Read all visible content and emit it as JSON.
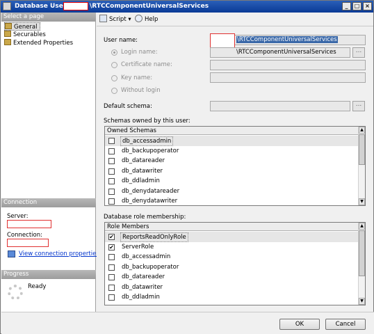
{
  "window": {
    "title_prefix": "Database User -",
    "title_suffix": "\\RTCComponentUniversalServices",
    "minimize": "_",
    "maximize": "□",
    "close": "×"
  },
  "sidebar": {
    "select_page_header": "Select a page",
    "items": [
      {
        "label": "General",
        "icon": "page-icon"
      },
      {
        "label": "Securables",
        "icon": "page-icon"
      },
      {
        "label": "Extended Properties",
        "icon": "page-icon"
      }
    ],
    "connection_header": "Connection",
    "server_label": "Server:",
    "connection_label": "Connection:",
    "view_connection_properties": "View connection properties",
    "progress_header": "Progress",
    "progress_status": "Ready"
  },
  "toolbar": {
    "script_label": "Script",
    "script_dropdown": "▾",
    "help_label": "Help"
  },
  "form": {
    "user_name_label": "User name:",
    "user_name_value": "\\RTCComponentUniversalServices",
    "login_name_label": "Login name:",
    "login_name_value": "\\RTCComponentUniversalServices",
    "certificate_name_label": "Certificate name:",
    "key_name_label": "Key name:",
    "without_login_label": "Without login",
    "default_schema_label": "Default schema:",
    "browse_button": "...",
    "schemas_owned_label": "Schemas owned by this user:",
    "role_membership_label": "Database role membership:"
  },
  "owned_schemas": {
    "header": "Owned Schemas",
    "rows": [
      {
        "name": "db_accessadmin",
        "checked": false
      },
      {
        "name": "db_backupoperator",
        "checked": false
      },
      {
        "name": "db_datareader",
        "checked": false
      },
      {
        "name": "db_datawriter",
        "checked": false
      },
      {
        "name": "db_ddladmin",
        "checked": false
      },
      {
        "name": "db_denydatareader",
        "checked": false
      },
      {
        "name": "db_denydatawriter",
        "checked": false
      }
    ]
  },
  "role_members": {
    "header": "Role Members",
    "rows": [
      {
        "name": "ReportsReadOnlyRole",
        "checked": true
      },
      {
        "name": "ServerRole",
        "checked": true
      },
      {
        "name": "db_accessadmin",
        "checked": false
      },
      {
        "name": "db_backupoperator",
        "checked": false
      },
      {
        "name": "db_datareader",
        "checked": false
      },
      {
        "name": "db_datawriter",
        "checked": false
      },
      {
        "name": "db_ddladmin",
        "checked": false
      }
    ]
  },
  "buttons": {
    "ok": "OK",
    "cancel": "Cancel"
  },
  "colors": {
    "title_bar": "#0a3a96",
    "redaction": "#e03030",
    "link": "#0033cc",
    "selection": "#3a68a8"
  }
}
